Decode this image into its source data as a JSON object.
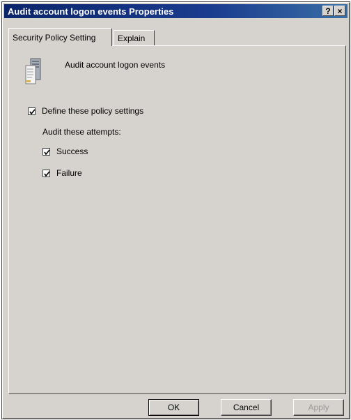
{
  "window": {
    "title": "Audit account logon events Properties"
  },
  "title_buttons": {
    "help": "?",
    "close": "×"
  },
  "tabs": [
    {
      "label": "Security Policy Setting",
      "active": true
    },
    {
      "label": "Explain",
      "active": false
    }
  ],
  "panel": {
    "icon": "server-document-icon",
    "policy_name": "Audit account logon events",
    "define": {
      "label": "Define these policy settings",
      "checked": true
    },
    "audit_label": "Audit these attempts:",
    "success": {
      "label": "Success",
      "checked": true
    },
    "failure": {
      "label": "Failure",
      "checked": true
    }
  },
  "buttons": {
    "ok": "OK",
    "cancel": "Cancel",
    "apply": "Apply"
  },
  "colors": {
    "titlebar": "#0a246a",
    "dialog_bg": "#d6d3ce",
    "disabled_text": "#9a9a9a"
  }
}
